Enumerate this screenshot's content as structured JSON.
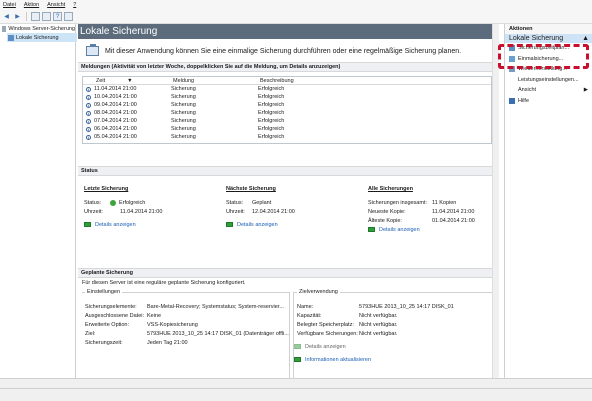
{
  "menu": [
    "Datei",
    "Aktion",
    "Ansicht",
    "?"
  ],
  "tree": {
    "root": "Windows Server-Sicherung",
    "child": "Lokale Sicherung"
  },
  "main": {
    "title": "Lokale Sicherung",
    "intro": "Mit dieser Anwendung können Sie eine einmalige Sicherung durchführen oder eine regelmäßige Sicherung planen.",
    "messages": {
      "heading": "Meldungen (Aktivität von letzter Woche, doppelklicken Sie auf die Meldung, um Details anzuzeigen)",
      "columns": [
        "Zeit",
        "Meldung",
        "Beschreibung"
      ],
      "rows": [
        {
          "time": "11.04.2014 21:00",
          "msg": "Sicherung",
          "desc": "Erfolgreich"
        },
        {
          "time": "10.04.2014 21:00",
          "msg": "Sicherung",
          "desc": "Erfolgreich"
        },
        {
          "time": "09.04.2014 21:00",
          "msg": "Sicherung",
          "desc": "Erfolgreich"
        },
        {
          "time": "08.04.2014 21:00",
          "msg": "Sicherung",
          "desc": "Erfolgreich"
        },
        {
          "time": "07.04.2014 21:00",
          "msg": "Sicherung",
          "desc": "Erfolgreich"
        },
        {
          "time": "06.04.2014 21:00",
          "msg": "Sicherung",
          "desc": "Erfolgreich"
        },
        {
          "time": "05.04.2014 21:00",
          "msg": "Sicherung",
          "desc": "Erfolgreich"
        }
      ]
    },
    "status": {
      "heading": "Status",
      "last": {
        "title": "Letzte Sicherung",
        "status_label": "Status:",
        "status_value": "Erfolgreich",
        "time_label": "Uhrzeit:",
        "time_value": "11.04.2014 21:00",
        "link": "Details anzeigen"
      },
      "next": {
        "title": "Nächste Sicherung",
        "status_label": "Status:",
        "status_value": "Geplant",
        "time_label": "Uhrzeit:",
        "time_value": "12.04.2014 21:00",
        "link": "Details anzeigen"
      },
      "all": {
        "title": "Alle Sicherungen",
        "total_label": "Sicherungen insgesamt:",
        "total_value": "11 Kopien",
        "newest_label": "Neueste Kopie:",
        "newest_value": "11.04.2014 21:00",
        "oldest_label": "Älteste Kopie:",
        "oldest_value": "01.04.2014 21:00",
        "link": "Details anzeigen"
      }
    },
    "planned": {
      "heading": "Geplante Sicherung",
      "note": "Für diesen Server ist eine reguläre geplante Sicherung konfiguriert.",
      "settings": {
        "label": "Einstellungen",
        "rows": [
          {
            "k": "Sicherungselemente:",
            "v": "Bare-Metal-Recovery; Systemstatus; System-reservier..."
          },
          {
            "k": "Ausgeschlossene Datei:",
            "v": "Keine"
          },
          {
            "k": "Erweiterte Option:",
            "v": "VSS-Kopiesicherung"
          },
          {
            "k": "Ziel:",
            "v": "5793HUE 2013_10_25 14:17 DISK_01 (Datenträger offli..."
          },
          {
            "k": "Sicherungszeit:",
            "v": "Jeden Tag 21:00"
          }
        ]
      },
      "target": {
        "label": "Zielverwendung",
        "rows": [
          {
            "k": "Name:",
            "v": "5793HUE 2013_10_25 14:17 DISK_01"
          },
          {
            "k": "Kapazität:",
            "v": "Nicht verfügbar."
          },
          {
            "k": "Belegter Speicherplatz:",
            "v": "Nicht verfügbar."
          },
          {
            "k": "Verfügbare Sicherungen:",
            "v": "Nicht verfügbar."
          }
        ],
        "details": "Details anzeigen",
        "refresh": "Informationen aktualisieren"
      }
    }
  },
  "actions": {
    "heading": "Aktionen",
    "section": "Lokale Sicherung",
    "items": [
      "Sicherungszeitplan...",
      "Einmalsicherung...",
      "Wiederherstellung...",
      "Leistungseinstellungen...",
      "Ansicht",
      "Hilfe"
    ]
  },
  "colors": {
    "highlight": "#c8102e",
    "title_bar": "#5c6c7c",
    "link": "#1a5fb4"
  }
}
